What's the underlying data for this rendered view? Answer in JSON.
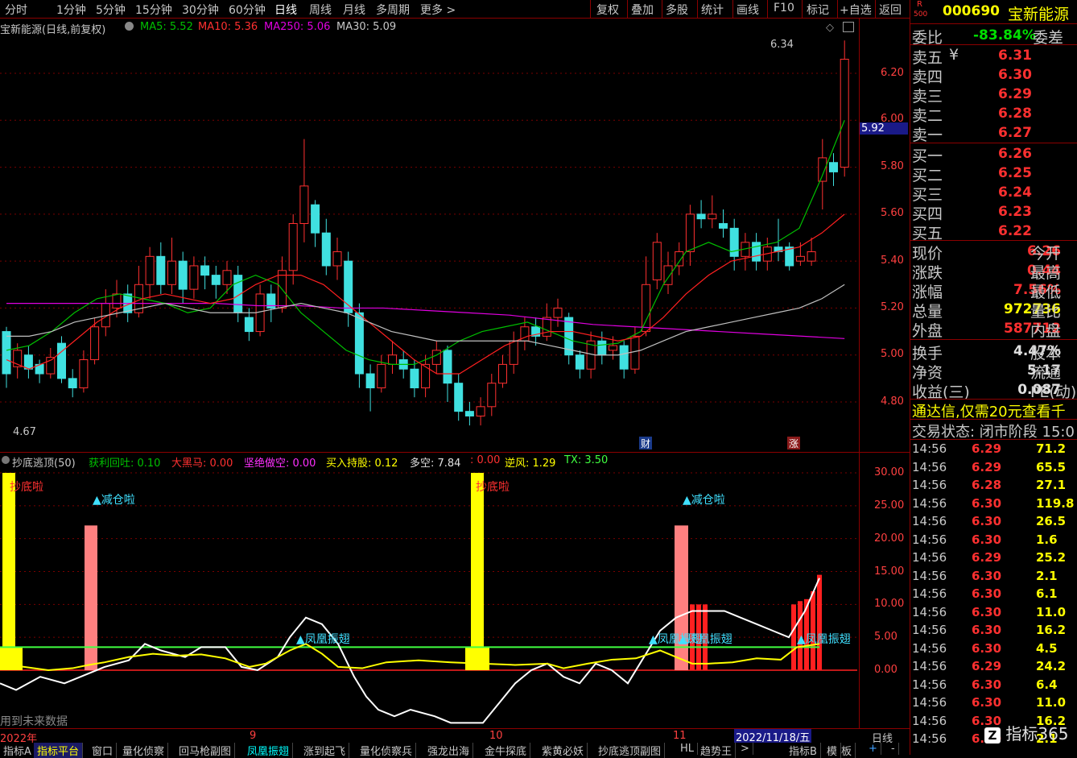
{
  "toolbar": {
    "periods": [
      "分时",
      "1分钟",
      "5分钟",
      "15分钟",
      "30分钟",
      "60分钟",
      "日线",
      "周线",
      "月线",
      "多周期",
      "更多 >"
    ],
    "active_period": "日线",
    "actions": [
      "复权",
      "叠加",
      "多股",
      "统计",
      "画线",
      "F10",
      "标记",
      "+自选",
      "返回"
    ]
  },
  "main": {
    "stock_title": "宝新能源(日线,前复权)",
    "ma5": "MA5: 5.52",
    "ma10": "MA10: 5.36",
    "ma250": "MA250: 5.06",
    "ma30": "MA30: 5.09",
    "high_marker": "6.34",
    "low_marker": "4.67",
    "current_price_box": "5.92",
    "price_axis": [
      "6.20",
      "6.00",
      "5.80",
      "5.60",
      "5.40",
      "5.20",
      "5.00",
      "4.80"
    ],
    "event_cai": "财",
    "event_zhang": "涨",
    "colors": {
      "ma5": "#00c000",
      "ma10": "#ff2020",
      "ma250": "#e000e0",
      "ma30": "#c0c0c0",
      "up": "#ff3030",
      "down": "#40e0e0"
    }
  },
  "indicator": {
    "name": "抄底逃顶(50)",
    "huoli": "获利回吐: 0.10",
    "daheima": "大黑马: 0.00",
    "jianjue": "坚绝做空: 0.00",
    "mairu": "买入持股: 0.12",
    "duokong": "多空: 7.84",
    "dot": ": 0.00",
    "nifeng": "逆风: 1.29",
    "tx": "TX: 3.50",
    "signal_chaodi": "抄底啦",
    "signal_jiancang": "▲减仓啦",
    "signal_fenghuang": "▲凤凰振翅",
    "footnote": "用到未来数据",
    "axis": [
      "30.00",
      "25.00",
      "20.00",
      "15.00",
      "10.00",
      "5.00",
      "0.00"
    ]
  },
  "date_axis": {
    "labels": [
      "2022年",
      "9",
      "10",
      "11"
    ],
    "cursor_date": "2022/11/18/五",
    "period": "日线"
  },
  "tabs": [
    "指标A",
    "指标平台",
    "窗口",
    "量化侦察",
    "回马枪副图",
    "凤凰振翅",
    "涨到起飞",
    "量化侦察兵",
    "强龙出海",
    "金牛探底",
    "紫黄必妖",
    "抄底逃顶副图",
    "HL",
    "趋势王",
    ">"
  ],
  "tabs_right": [
    "指标B",
    "模",
    "板",
    "+",
    "-"
  ],
  "right_panel": {
    "code": "000690",
    "name": "宝新能源",
    "badge_top": "R",
    "badge_bottom": "500",
    "weibi_label": "委比",
    "weibi_value": "-83.84%",
    "weicha_label": "委差",
    "asks": [
      {
        "label": "卖五",
        "price": "6.31",
        "tail": "¥"
      },
      {
        "label": "卖四",
        "price": "6.30"
      },
      {
        "label": "卖三",
        "price": "6.29"
      },
      {
        "label": "卖二",
        "price": "6.28"
      },
      {
        "label": "卖一",
        "price": "6.27"
      }
    ],
    "bids": [
      {
        "label": "买一",
        "price": "6.26"
      },
      {
        "label": "买二",
        "price": "6.25"
      },
      {
        "label": "买三",
        "price": "6.24"
      },
      {
        "label": "买四",
        "price": "6.23"
      },
      {
        "label": "买五",
        "price": "6.22"
      }
    ],
    "stats": [
      {
        "label": "现价",
        "value": "6.26",
        "color": "#ff3030",
        "tail": "今开"
      },
      {
        "label": "涨跌",
        "value": "0.44",
        "color": "#ff3030",
        "tail": "最高"
      },
      {
        "label": "涨幅",
        "value": "7.56%",
        "color": "#ff3030",
        "tail": "最低"
      },
      {
        "label": "总量",
        "value": "972736",
        "color": "#ffff00",
        "tail": "量比"
      },
      {
        "label": "外盘",
        "value": "587712",
        "color": "#ff3030",
        "tail": "内盘"
      }
    ],
    "stats2": [
      {
        "label": "换手",
        "value": "4.47%",
        "color": "#e0e0e0",
        "tail": "股本"
      },
      {
        "label": "净资",
        "value": "5.17",
        "color": "#e0e0e0",
        "tail": "流通"
      },
      {
        "label": "收益(三)",
        "value": "0.087",
        "color": "#e0e0e0",
        "tail": "PE(动)"
      }
    ],
    "promo": "通达信,仅需20元查看千",
    "status": "交易状态: 闭市阶段 15:0",
    "ticks": [
      {
        "t": "14:56",
        "p": "6.29",
        "v": "71.2",
        "c": "#ff3030"
      },
      {
        "t": "14:56",
        "p": "6.29",
        "v": "65.5",
        "c": "#ff3030"
      },
      {
        "t": "14:56",
        "p": "6.28",
        "v": "27.1",
        "c": "#ff3030"
      },
      {
        "t": "14:56",
        "p": "6.30",
        "v": "119.8",
        "c": "#ff3030"
      },
      {
        "t": "14:56",
        "p": "6.30",
        "v": "26.5",
        "c": "#ff3030"
      },
      {
        "t": "14:56",
        "p": "6.30",
        "v": "1.6",
        "c": "#ff3030"
      },
      {
        "t": "14:56",
        "p": "6.29",
        "v": "25.2",
        "c": "#ff3030"
      },
      {
        "t": "14:56",
        "p": "6.30",
        "v": "2.1",
        "c": "#ff3030"
      },
      {
        "t": "14:56",
        "p": "6.30",
        "v": "6.1",
        "c": "#ff3030"
      },
      {
        "t": "14:56",
        "p": "6.30",
        "v": "11.0",
        "c": "#ff3030"
      },
      {
        "t": "14:56",
        "p": "6.30",
        "v": "16.2",
        "c": "#ff3030"
      },
      {
        "t": "14:56",
        "p": "6.30",
        "v": "4.5",
        "c": "#ff3030"
      },
      {
        "t": "14:56",
        "p": "6.29",
        "v": "24.2",
        "c": "#ff3030"
      },
      {
        "t": "14:56",
        "p": "6.30",
        "v": "6.4",
        "c": "#ff3030"
      },
      {
        "t": "14:56",
        "p": "6.30",
        "v": "11.0",
        "c": "#ff3030"
      },
      {
        "t": "14:56",
        "p": "6.30",
        "v": "16.2",
        "c": "#ff3030"
      },
      {
        "t": "14:56",
        "p": "6.30",
        "v": "2.1",
        "c": "#ff3030"
      }
    ],
    "watermark": "指标365"
  }
}
